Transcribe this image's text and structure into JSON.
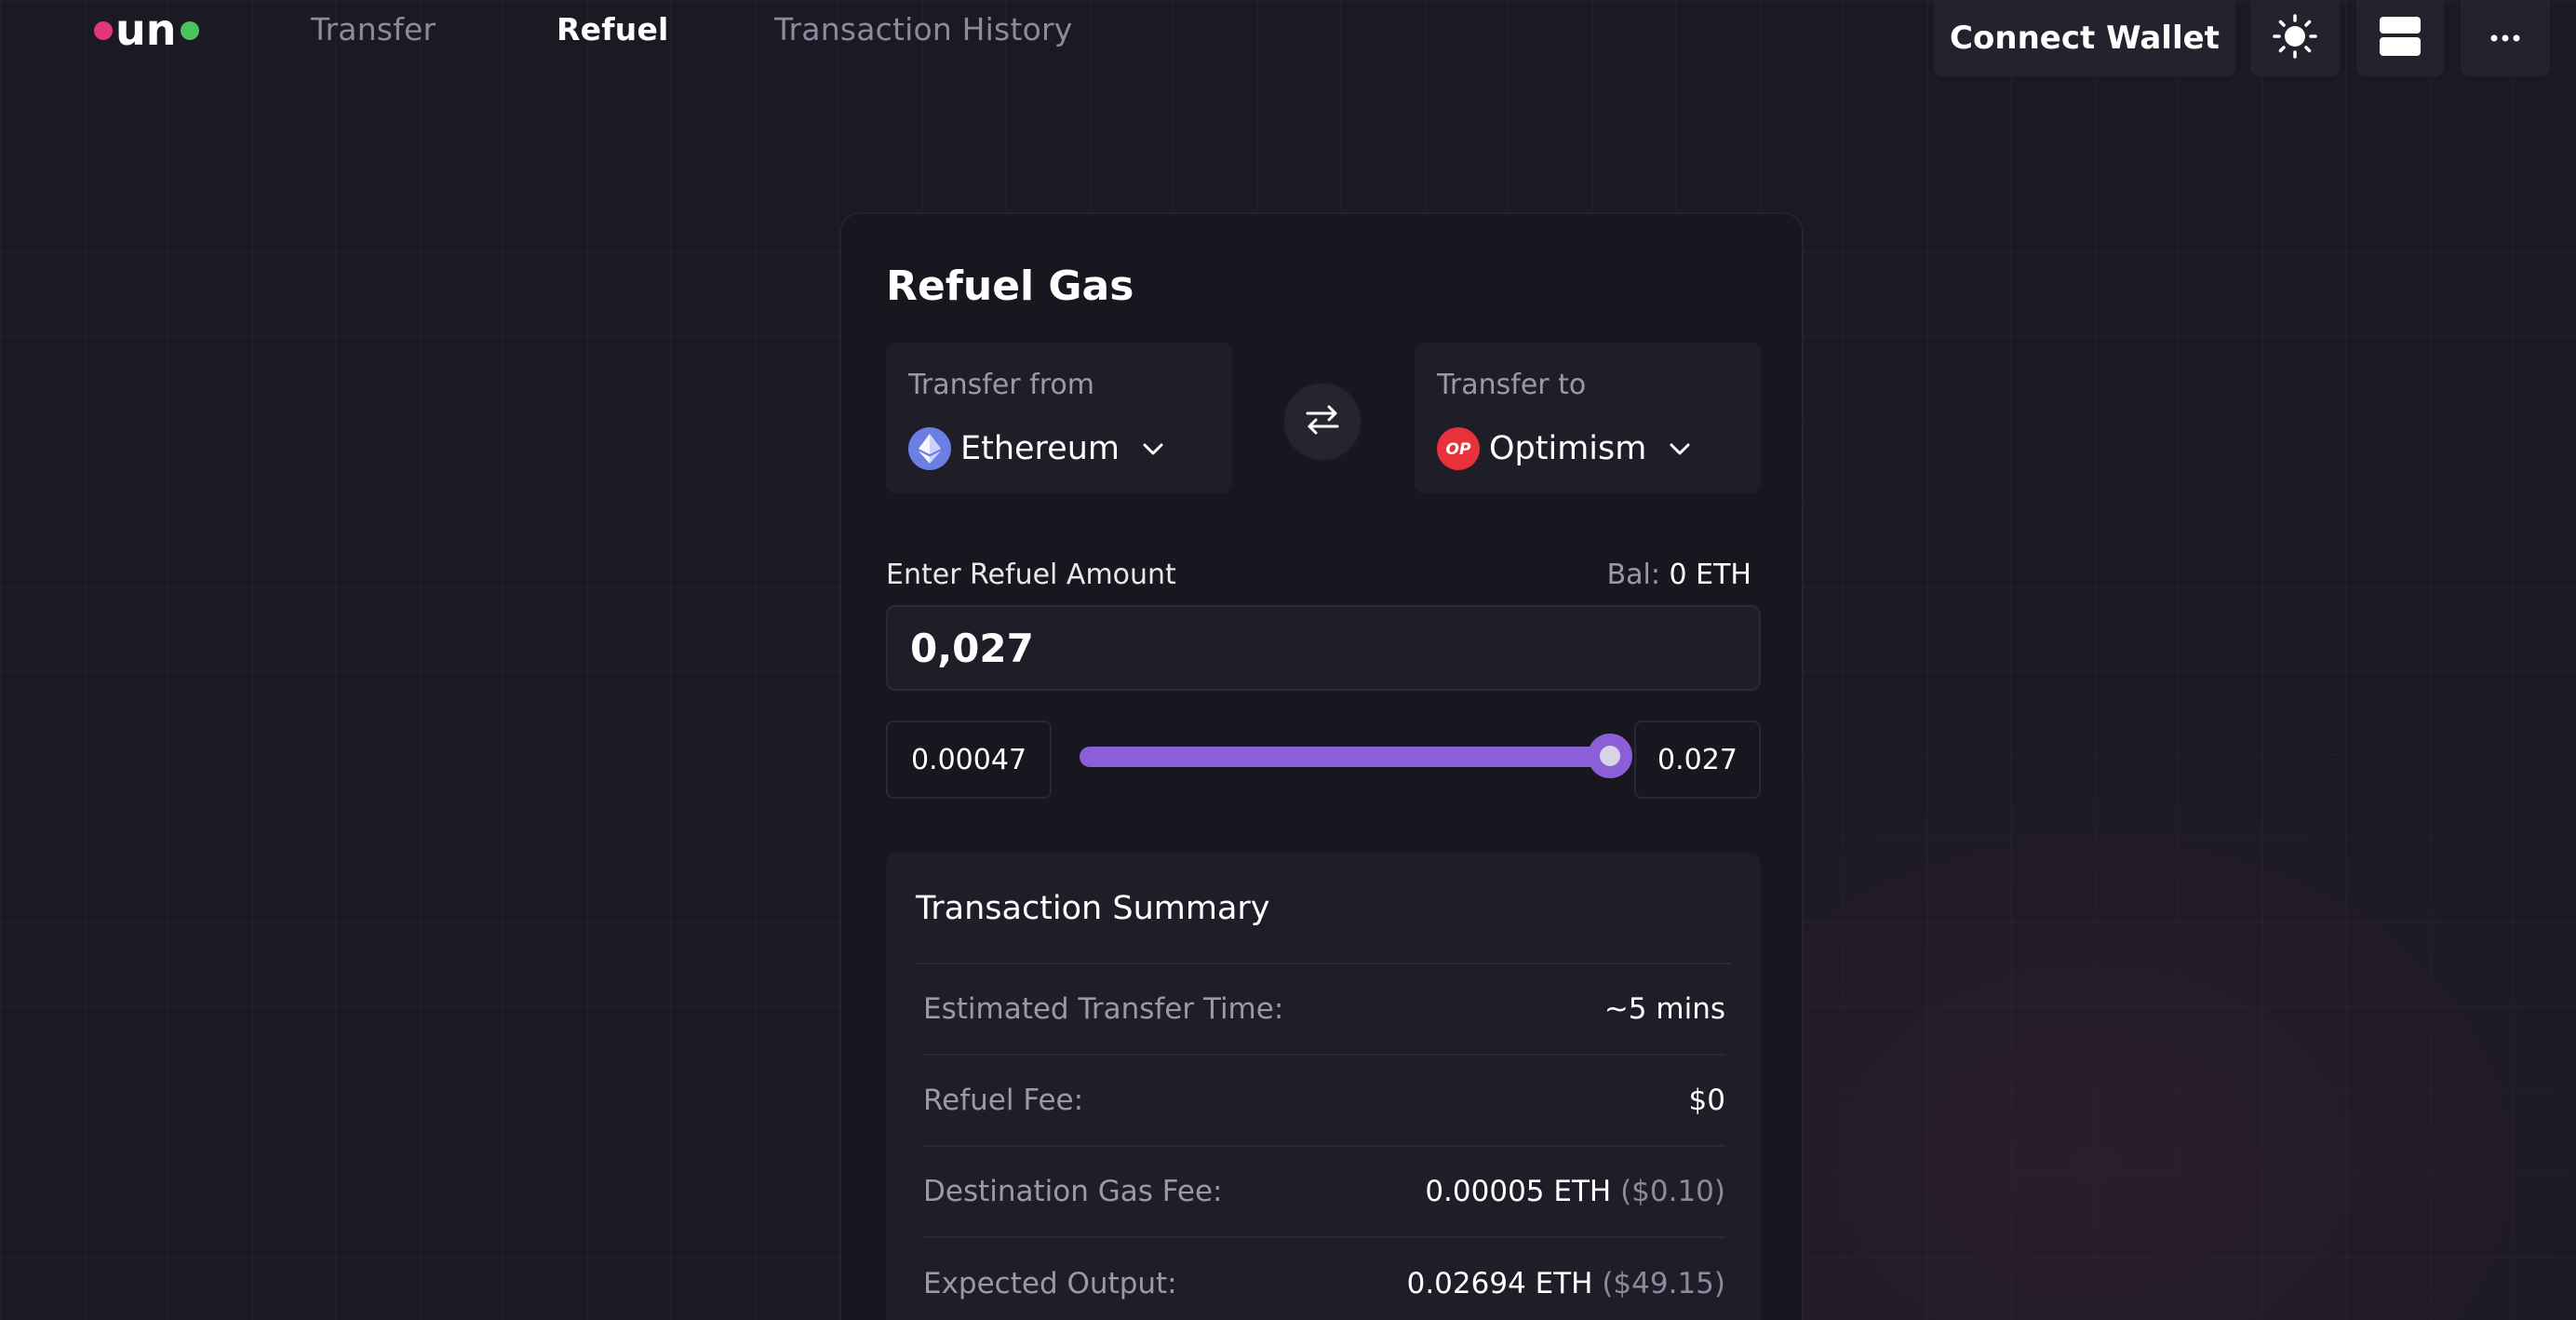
{
  "colors": {
    "background": "#1b1a23",
    "card": "#18171f",
    "panel": "#1f1e28",
    "accent": "#8b5fd8",
    "logo_pink": "#e0367a",
    "logo_green": "#4cc25f",
    "ethereum": "#6b7fe3",
    "optimism": "#e8313a"
  },
  "logo": {
    "text": "un"
  },
  "nav": {
    "transfer": "Transfer",
    "refuel": "Refuel",
    "history": "Transaction History"
  },
  "header": {
    "connect_wallet": "Connect Wallet",
    "icons": [
      "sun-icon",
      "layout-icon",
      "more-icon"
    ]
  },
  "card": {
    "title": "Refuel Gas",
    "from": {
      "label": "Transfer from",
      "chain": "Ethereum",
      "icon": "ethereum-icon"
    },
    "to": {
      "label": "Transfer to",
      "chain": "Optimism",
      "icon": "optimism-icon",
      "icon_text": "OP"
    },
    "amount": {
      "label": "Enter Refuel Amount",
      "balance_label": "Bal: ",
      "balance_value": "0 ETH",
      "value": "0,027"
    },
    "slider": {
      "min": "0.00047",
      "max": "0.027",
      "position": 1.0
    },
    "summary": {
      "title": "Transaction Summary",
      "rows": [
        {
          "label": "Estimated Transfer Time:",
          "value": "~5 mins",
          "sub": ""
        },
        {
          "label": "Refuel Fee:",
          "value": "$0",
          "sub": ""
        },
        {
          "label": "Destination Gas Fee:",
          "value": "0.00005 ETH ",
          "sub": "($0.10)"
        },
        {
          "label": "Expected Output:",
          "value": "0.02694 ETH ",
          "sub": "($49.15)"
        }
      ]
    }
  }
}
